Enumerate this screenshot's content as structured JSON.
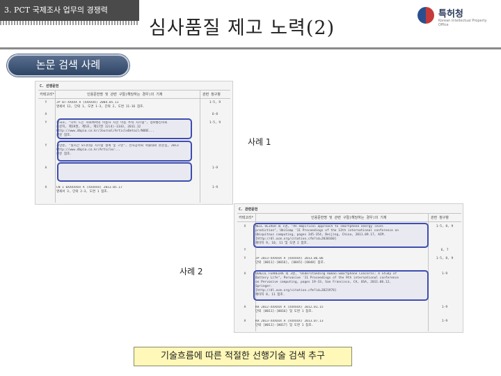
{
  "header": {
    "section": "3. PCT 국제조사 업무의 경쟁력",
    "title": "심사품질 제고 노력(2)",
    "logo": {
      "name": "특허청",
      "subtitle": "Korean Intellectual Property Office"
    }
  },
  "badge": "논문 검색 사례",
  "document1": {
    "section": "C. 선행문헌",
    "headers": [
      "카테고리*",
      "인용문헌명 및 관련 구절(해당하는 경우)의 기재",
      "관련 청구항"
    ],
    "rows": [
      {
        "cat": "Y",
        "text": "JP 07-XXXXX A (XXXXXX) 2004.05.11\n명세서 12, 단락 1, 도면 1-3, 단락 2, 도면 11-16 참조.",
        "claims": "1-5, 9"
      },
      {
        "cat": "A",
        "text": "",
        "claims": "6-8"
      },
      {
        "cat": "Y",
        "text": "한국호, \"나이 드는 사회에서의 이용자 시선 이동 추적 시스템\", 정보통신학회\n논문지, 제19권, 제5호, 제17권 12(4)-1343, 2011.12\nhttp://www.dbpia.co.kr/Journal/ArticleDetail/NODE...\n본문 참조.",
        "claims": "1-5, 9"
      },
      {
        "cat": "Y",
        "text": "고양준, \"실시간 모니터링 시스템 설계 및 구현\", 전자공학회 학술대회 논문집, 2013\nhttp://www.dbpia.co.kr/Article/...\n본문 참조.",
        "claims": ""
      },
      {
        "cat": "A",
        "text": "",
        "claims": "1-9"
      },
      {
        "cat": "A",
        "text": "CN 1 0XXXXXXX A (XXXXXX) 2013.05.17\n명세서 3, 단락 2-3, 도면 1 참조.",
        "claims": "1-9"
      }
    ]
  },
  "document2": {
    "section": "C. 관련문헌",
    "headers": [
      "카테고리*",
      "인용문헌명 및 관련 구절(해당하는 경우)의 기재",
      "관련 청구항"
    ],
    "rows": [
      {
        "cat": "X",
        "text": "NEIL OLIVER 외 1명, \"An empirical approach to smartphone energy level\nprediction\", UbiComp '11 Proceedings of the 13th international conference on\nUbiquitous computing, pages 345-354, Beijing, China, 2011.09.17, ACM.\n[http://dl.acm.org/citation.cfm?id=2030160]\n페이지 9, 10, 11 및 도면 2 참조.",
        "claims": "1-5, 8, 9"
      },
      {
        "cat": "Y",
        "text": "",
        "claims": "6, 7"
      },
      {
        "cat": "Y",
        "text": "JP 2013-XXXXXX A (XXXXXX) 2013.06.06\n단락 [0011]-[0016], [0045]-[0048] 참조.",
        "claims": "1-5, 8, 9"
      },
      {
        "cat": "A",
        "text": "DENZIL FERREIRA 외 3명, \"Understanding Human-Smartphone Concerns: A Study of\nBattery Life\", Pervasive '11 Proceedings of the 9th international conference\non Pervasive computing, pages 19-33, San Francisco, CA, USA, 2011.06.12,\nSpringer.\n[http://dl.acm.org/citation.cfm?id=2021978]\n페이지 8, 11 참조.",
        "claims": "1-9"
      },
      {
        "cat": "A",
        "text": "KR 2012-XXXXXX A (XXXXXX) 2012.01.15\n단락 [0011]-[0016] 및 도면 1 참조.",
        "claims": "1-9"
      },
      {
        "cat": "A",
        "text": "KR 2013-XXXXXX A (XXXXXX) 2013.07.13\n단락 [0011]-[0017] 및 도면 1 참조.",
        "claims": "1-9"
      }
    ]
  },
  "labels": {
    "case1": "사례 1",
    "case2": "사례 2",
    "caption": "기술흐름에 따른 적절한 선행기술 검색 추구"
  },
  "colors": {
    "header_tab": "#4a4a4a",
    "badge": "#3e5475",
    "highlight": "#3d4cb0",
    "caption_bg": "#fff8b8"
  }
}
